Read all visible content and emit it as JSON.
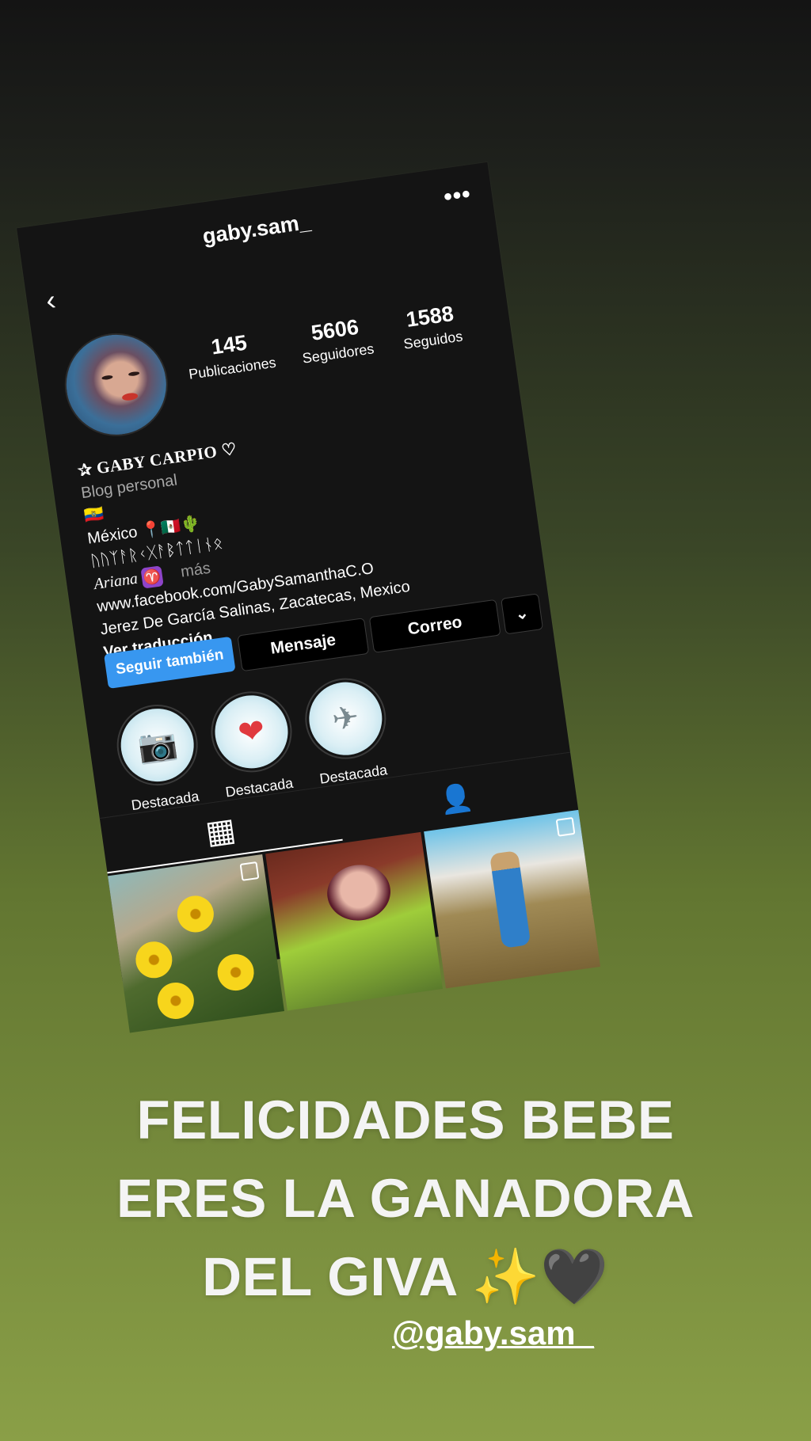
{
  "profile": {
    "username": "gaby.sam_",
    "back_icon": "‹",
    "more_icon": "•••",
    "stats": [
      {
        "value": "145",
        "label": "Publicaciones"
      },
      {
        "value": "5606",
        "label": "Seguidores"
      },
      {
        "value": "1588",
        "label": "Seguidos"
      }
    ],
    "bio": {
      "name": "✰ GABY CARPIO ♡",
      "category": "Blog personal",
      "flag_line": "🇪🇨",
      "location_line": "México 📍🇲🇽🌵",
      "runic_line": "ᚢᚢᛉᚨᚱᚲᚷᚨᛒᛏᛏᛁᚾᛟ",
      "ariana": "Ariana",
      "aries_symbol": "♈",
      "more": "más",
      "link": "www.facebook.com/GabySamanthaC.O",
      "address": "Jerez De García Salinas, Zacatecas, Mexico",
      "translate": "Ver traducción"
    },
    "buttons": {
      "follow": "Seguir también",
      "message": "Mensaje",
      "email": "Correo",
      "dropdown": "⌄"
    },
    "highlights": [
      {
        "label": "Destacada",
        "icon": "📷"
      },
      {
        "label": "Destacada",
        "icon": "❤"
      },
      {
        "label": "Destacada",
        "icon": "✈"
      }
    ],
    "tabs": {
      "grid_icon": "▦",
      "tagged_icon": "👤"
    }
  },
  "story": {
    "headline_lines": [
      "FELICIDADES BEBE",
      "ERES LA GANADORA",
      "DEL GIVA ✨🖤"
    ],
    "mention": "@gaby.sam_"
  },
  "colors": {
    "follow_blue": "#3897f0",
    "card_bg": "#141414",
    "bg_top": "#141414",
    "bg_bottom": "#8a9f47"
  }
}
